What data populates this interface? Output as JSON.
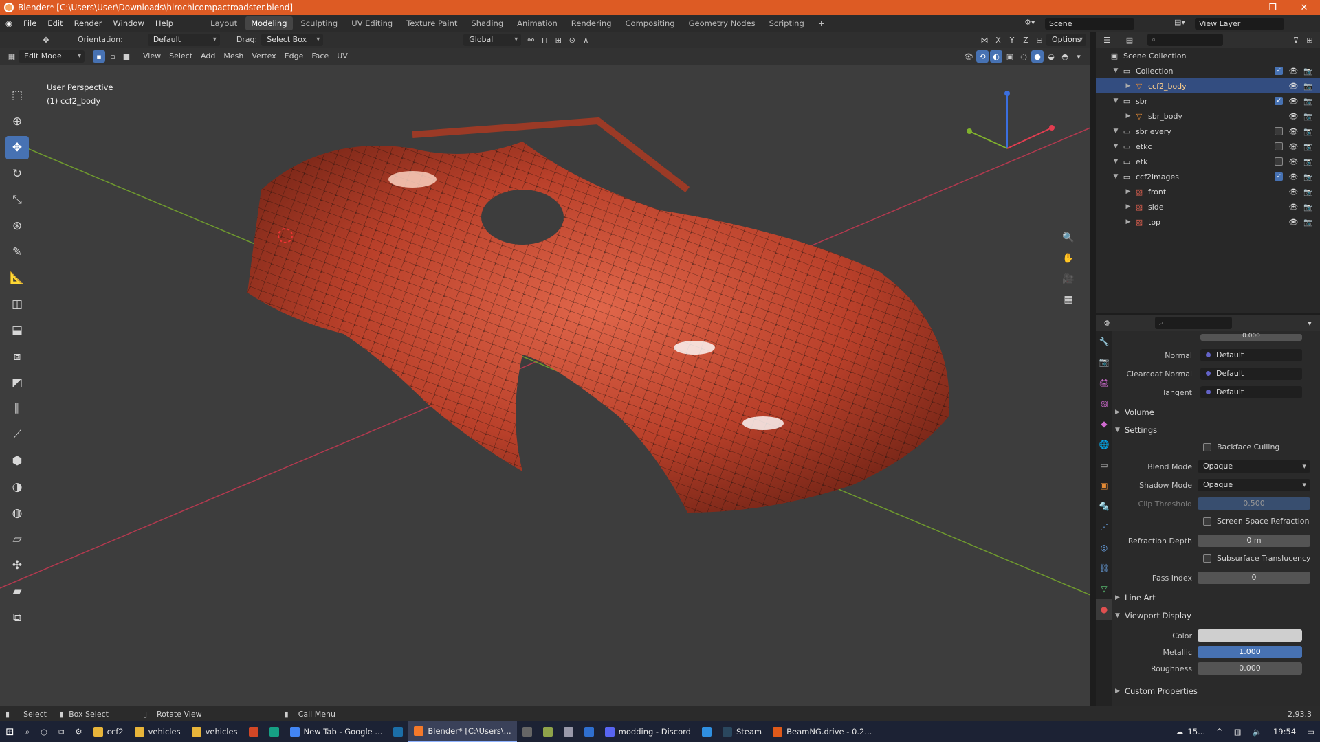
{
  "window": {
    "title": "Blender* [C:\\Users\\User\\Downloads\\hirochicompactroadster.blend]"
  },
  "menu": [
    "File",
    "Edit",
    "Render",
    "Window",
    "Help"
  ],
  "workspaces": [
    "Layout",
    "Modeling",
    "Sculpting",
    "UV Editing",
    "Texture Paint",
    "Shading",
    "Animation",
    "Rendering",
    "Compositing",
    "Geometry Nodes",
    "Scripting"
  ],
  "active_workspace": "Modeling",
  "scene": "Scene",
  "view_layer": "View Layer",
  "header": {
    "orientation_label": "Orientation:",
    "orientation": "Default",
    "drag_label": "Drag:",
    "drag": "Select Box",
    "transform": "Global",
    "options": "Options",
    "axes": [
      "X",
      "Y",
      "Z"
    ]
  },
  "header2": {
    "mode": "Edit Mode",
    "menus": [
      "View",
      "Select",
      "Add",
      "Mesh",
      "Vertex",
      "Edge",
      "Face",
      "UV"
    ]
  },
  "viewport": {
    "perspective": "User Perspective",
    "object": "(1) ccf2_body"
  },
  "tools": [
    "select-box",
    "cursor",
    "move",
    "rotate",
    "scale",
    "transform",
    "annotate",
    "measure",
    "add-cube",
    "extrude",
    "inset",
    "bevel",
    "loop-cut",
    "knife",
    "poly-build",
    "spin",
    "smooth",
    "edge-slide",
    "shrink-fatten",
    "shear",
    "rip"
  ],
  "outliner": {
    "rows": [
      {
        "label": "Scene Collection",
        "indent": 0,
        "type": "scene"
      },
      {
        "label": "Collection",
        "indent": 1,
        "type": "collection",
        "checked": true
      },
      {
        "label": "ccf2_body",
        "indent": 2,
        "type": "mesh",
        "selected": true
      },
      {
        "label": "sbr",
        "indent": 1,
        "type": "collection",
        "checked": true
      },
      {
        "label": "sbr_body",
        "indent": 2,
        "type": "mesh"
      },
      {
        "label": "sbr every",
        "indent": 1,
        "type": "collection",
        "checked": false
      },
      {
        "label": "etkc",
        "indent": 1,
        "type": "collection",
        "checked": false
      },
      {
        "label": "etk",
        "indent": 1,
        "type": "collection",
        "checked": false
      },
      {
        "label": "ccf2images",
        "indent": 1,
        "type": "collection",
        "checked": true
      },
      {
        "label": "front",
        "indent": 2,
        "type": "image"
      },
      {
        "label": "side",
        "indent": 2,
        "type": "image"
      },
      {
        "label": "top",
        "indent": 2,
        "type": "image"
      }
    ]
  },
  "properties": {
    "alpha_value": "0.000",
    "normal_label": "Normal",
    "normal": "Default",
    "clearcoat_label": "Clearcoat Normal",
    "clearcoat": "Default",
    "tangent_label": "Tangent",
    "tangent": "Default",
    "volume": "Volume",
    "settings": "Settings",
    "backface": "Backface Culling",
    "blend_label": "Blend Mode",
    "blend": "Opaque",
    "shadow_label": "Shadow Mode",
    "shadow": "Opaque",
    "clip_label": "Clip Threshold",
    "clip": "0.500",
    "ssr": "Screen Space Refraction",
    "refr_label": "Refraction Depth",
    "refr": "0 m",
    "sss": "Subsurface Translucency",
    "pass_label": "Pass Index",
    "pass": "0",
    "lineart": "Line Art",
    "viewport_display": "Viewport Display",
    "color_label": "Color",
    "metallic_label": "Metallic",
    "metallic": "1.000",
    "roughness_label": "Roughness",
    "roughness": "0.000",
    "custom": "Custom Properties"
  },
  "status": {
    "select": "Select",
    "box_select": "Box Select",
    "rotate": "Rotate View",
    "call_menu": "Call Menu",
    "version": "2.93.3"
  },
  "taskbar": {
    "items": [
      {
        "label": "ccf2",
        "color": "#e8b53a"
      },
      {
        "label": "vehicles",
        "color": "#e8b53a"
      },
      {
        "label": "vehicles",
        "color": "#e8b53a"
      },
      {
        "label": "",
        "color": "#d24726"
      },
      {
        "label": "",
        "color": "#16a085"
      },
      {
        "label": "New Tab - Google ...",
        "color": "#4285f4"
      },
      {
        "label": "",
        "color": "#1b6ea8"
      },
      {
        "label": "Blender* [C:\\Users\\...",
        "color": "#f5792a",
        "active": true
      },
      {
        "label": "",
        "color": "#666666"
      },
      {
        "label": "",
        "color": "#8fa34a"
      },
      {
        "label": "",
        "color": "#9999aa"
      },
      {
        "label": "",
        "color": "#2f6fd0"
      },
      {
        "label": "modding - Discord",
        "color": "#5865f2"
      },
      {
        "label": "",
        "color": "#2f8fe0"
      },
      {
        "label": "Steam",
        "color": "#2a475e"
      },
      {
        "label": "BeamNG.drive - 0.2...",
        "color": "#e05a1a"
      }
    ],
    "weather": "15...",
    "time": "19:54"
  },
  "colors": {
    "accent": "#4772b3",
    "title": "#dd5b24",
    "car": "#c8492e"
  }
}
